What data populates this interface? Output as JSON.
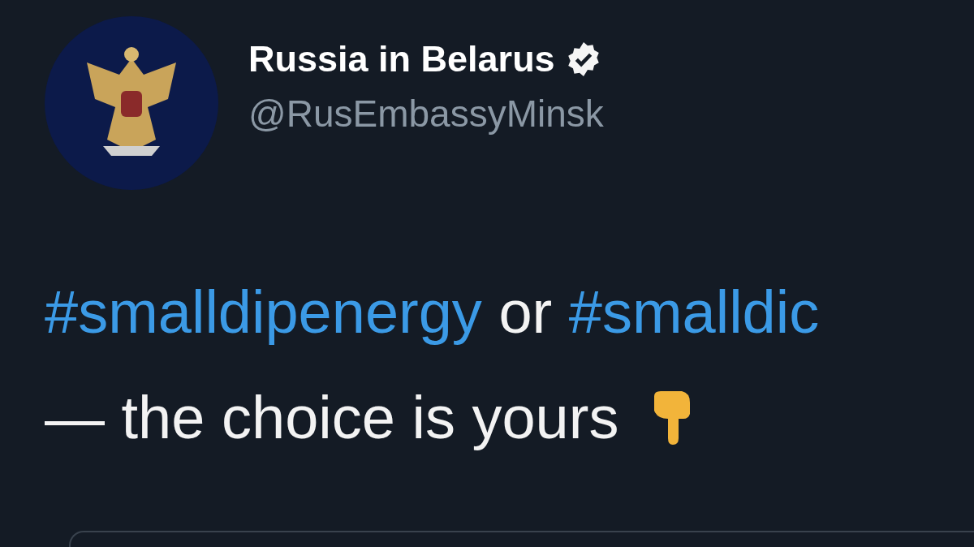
{
  "author": {
    "name": "Russia in Belarus",
    "verified": true,
    "handle": "@RusEmbassyMinsk"
  },
  "tweet": {
    "lines": [
      [
        {
          "kind": "hashtag",
          "text": "#smalldipenergy"
        },
        {
          "kind": "text",
          "text": " or "
        },
        {
          "kind": "hashtag",
          "text": "#smalldic"
        }
      ],
      [
        {
          "kind": "text",
          "text": "— the choice is yours"
        },
        {
          "kind": "emoji"
        }
      ]
    ]
  }
}
